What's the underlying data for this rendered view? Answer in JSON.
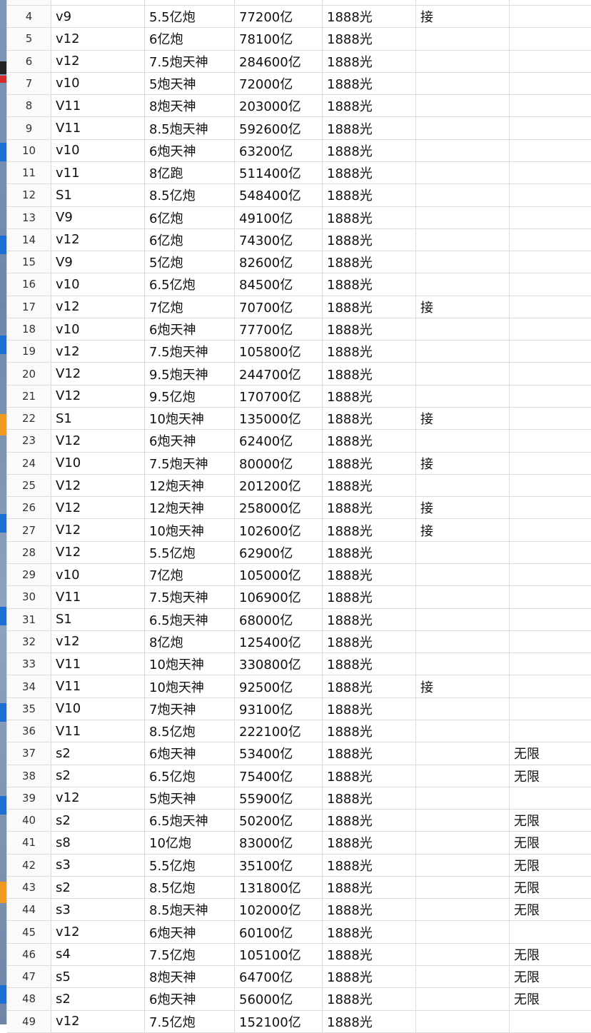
{
  "rows": [
    {
      "n": "4",
      "a": "v9",
      "b": "5.5亿炮",
      "c": "77200亿",
      "d": "1888光",
      "e": "接",
      "f": ""
    },
    {
      "n": "5",
      "a": "v12",
      "b": "6亿炮",
      "c": "78100亿",
      "d": "1888光",
      "e": "",
      "f": ""
    },
    {
      "n": "6",
      "a": "v12",
      "b": "7.5炮天神",
      "c": "284600亿",
      "d": "1888光",
      "e": "",
      "f": ""
    },
    {
      "n": "7",
      "a": "v10",
      "b": "5炮天神",
      "c": "72000亿",
      "d": "1888光",
      "e": "",
      "f": ""
    },
    {
      "n": "8",
      "a": "V11",
      "b": "8炮天神",
      "c": "203000亿",
      "d": "1888光",
      "e": "",
      "f": ""
    },
    {
      "n": "9",
      "a": "V11",
      "b": "8.5炮天神",
      "c": "592600亿",
      "d": "1888光",
      "e": "",
      "f": ""
    },
    {
      "n": "10",
      "a": "v10",
      "b": "6炮天神",
      "c": "63200亿",
      "d": "1888光",
      "e": "",
      "f": ""
    },
    {
      "n": "11",
      "a": "v11",
      "b": "8亿跑",
      "c": "511400亿",
      "d": "1888光",
      "e": "",
      "f": ""
    },
    {
      "n": "12",
      "a": "S1",
      "b": "8.5亿炮",
      "c": "548400亿",
      "d": "1888光",
      "e": "",
      "f": ""
    },
    {
      "n": "13",
      "a": "V9",
      "b": "6亿炮",
      "c": "49100亿",
      "d": "1888光",
      "e": "",
      "f": ""
    },
    {
      "n": "14",
      "a": "v12",
      "b": "6亿炮",
      "c": "74300亿",
      "d": "1888光",
      "e": "",
      "f": ""
    },
    {
      "n": "15",
      "a": "V9",
      "b": "5亿炮",
      "c": "82600亿",
      "d": "1888光",
      "e": "",
      "f": ""
    },
    {
      "n": "16",
      "a": "v10",
      "b": "6.5亿炮",
      "c": "84500亿",
      "d": "1888光",
      "e": "",
      "f": ""
    },
    {
      "n": "17",
      "a": "v12",
      "b": "7亿炮",
      "c": "70700亿",
      "d": "1888光",
      "e": "接",
      "f": ""
    },
    {
      "n": "18",
      "a": "v10",
      "b": "6炮天神",
      "c": "77700亿",
      "d": "1888光",
      "e": "",
      "f": ""
    },
    {
      "n": "19",
      "a": "v12",
      "b": "7.5炮天神",
      "c": "105800亿",
      "d": "1888光",
      "e": "",
      "f": ""
    },
    {
      "n": "20",
      "a": "V12",
      "b": "9.5炮天神",
      "c": "244700亿",
      "d": "1888光",
      "e": "",
      "f": ""
    },
    {
      "n": "21",
      "a": "V12",
      "b": "9.5亿炮",
      "c": "170700亿",
      "d": "1888光",
      "e": "",
      "f": ""
    },
    {
      "n": "22",
      "a": "S1",
      "b": "10炮天神",
      "c": "135000亿",
      "d": "1888光",
      "e": "接",
      "f": ""
    },
    {
      "n": "23",
      "a": "V12",
      "b": "6炮天神",
      "c": "62400亿",
      "d": "1888光",
      "e": "",
      "f": ""
    },
    {
      "n": "24",
      "a": "V10",
      "b": "7.5炮天神",
      "c": "80000亿",
      "d": "1888光",
      "e": "接",
      "f": ""
    },
    {
      "n": "25",
      "a": "V12",
      "b": "12炮天神",
      "c": "201200亿",
      "d": "1888光",
      "e": "",
      "f": ""
    },
    {
      "n": "26",
      "a": "V12",
      "b": "12炮天神",
      "c": "258000亿",
      "d": "1888光",
      "e": "接",
      "f": ""
    },
    {
      "n": "27",
      "a": "V12",
      "b": "10炮天神",
      "c": "102600亿",
      "d": "1888光",
      "e": "接",
      "f": ""
    },
    {
      "n": "28",
      "a": "V12",
      "b": "5.5亿炮",
      "c": "62900亿",
      "d": "1888光",
      "e": "",
      "f": ""
    },
    {
      "n": "29",
      "a": "v10",
      "b": "7亿炮",
      "c": "105000亿",
      "d": "1888光",
      "e": "",
      "f": ""
    },
    {
      "n": "30",
      "a": "V11",
      "b": "7.5炮天神",
      "c": "106900亿",
      "d": "1888光",
      "e": "",
      "f": ""
    },
    {
      "n": "31",
      "a": "S1",
      "b": "6.5炮天神",
      "c": "68000亿",
      "d": "1888光",
      "e": "",
      "f": ""
    },
    {
      "n": "32",
      "a": "v12",
      "b": "8亿炮",
      "c": "125400亿",
      "d": "1888光",
      "e": "",
      "f": ""
    },
    {
      "n": "33",
      "a": "V11",
      "b": "10炮天神",
      "c": "330800亿",
      "d": "1888光",
      "e": "",
      "f": ""
    },
    {
      "n": "34",
      "a": "V11",
      "b": "10炮天神",
      "c": "92500亿",
      "d": "1888光",
      "e": "接",
      "f": ""
    },
    {
      "n": "35",
      "a": "V10",
      "b": "7炮天神",
      "c": "93100亿",
      "d": "1888光",
      "e": "",
      "f": ""
    },
    {
      "n": "36",
      "a": "V11",
      "b": "8.5亿炮",
      "c": "222100亿",
      "d": "1888光",
      "e": "",
      "f": ""
    },
    {
      "n": "37",
      "a": "s2",
      "b": "6炮天神",
      "c": "53400亿",
      "d": "1888光",
      "e": "",
      "f": "无限"
    },
    {
      "n": "38",
      "a": "s2",
      "b": "6.5亿炮",
      "c": "75400亿",
      "d": "1888光",
      "e": "",
      "f": "无限"
    },
    {
      "n": "39",
      "a": "v12",
      "b": "5炮天神",
      "c": "55900亿",
      "d": "1888光",
      "e": "",
      "f": ""
    },
    {
      "n": "40",
      "a": "s2",
      "b": "6.5炮天神",
      "c": "50200亿",
      "d": "1888光",
      "e": "",
      "f": "无限"
    },
    {
      "n": "41",
      "a": "s8",
      "b": "10亿炮",
      "c": "83000亿",
      "d": "1888光",
      "e": "",
      "f": "无限"
    },
    {
      "n": "42",
      "a": "s3",
      "b": "5.5亿炮",
      "c": "35100亿",
      "d": "1888光",
      "e": "",
      "f": "无限"
    },
    {
      "n": "43",
      "a": "s2",
      "b": "8.5亿炮",
      "c": "131800亿",
      "d": "1888光",
      "e": "",
      "f": "无限"
    },
    {
      "n": "44",
      "a": "s3",
      "b": "8.5炮天神",
      "c": "102000亿",
      "d": "1888光",
      "e": "",
      "f": "无限"
    },
    {
      "n": "45",
      "a": "v12",
      "b": "6炮天神",
      "c": "60100亿",
      "d": "1888光",
      "e": "",
      "f": ""
    },
    {
      "n": "46",
      "a": "s4",
      "b": "7.5亿炮",
      "c": "105100亿",
      "d": "1888光",
      "e": "",
      "f": "无限"
    },
    {
      "n": "47",
      "a": "s5",
      "b": "8炮天神",
      "c": "64700亿",
      "d": "1888光",
      "e": "",
      "f": "无限"
    },
    {
      "n": "48",
      "a": "s2",
      "b": "6炮天神",
      "c": "56000亿",
      "d": "1888光",
      "e": "",
      "f": "无限"
    },
    {
      "n": "49",
      "a": "v12",
      "b": "7.5亿炮",
      "c": "152100亿",
      "d": "1888光",
      "e": "",
      "f": ""
    }
  ]
}
